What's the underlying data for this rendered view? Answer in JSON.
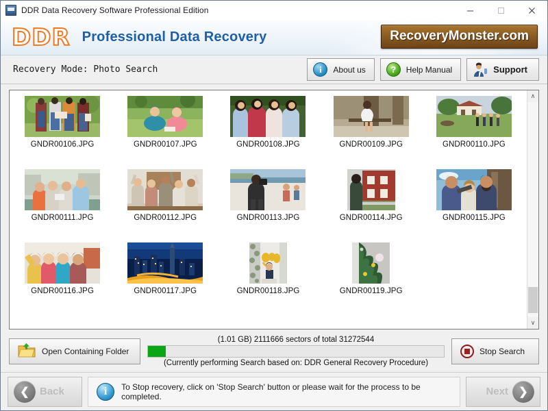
{
  "window": {
    "title": "DDR Data Recovery Software Professional Edition",
    "app_icon": "app-icon",
    "minimize": "—",
    "maximize": "□",
    "close": "✕"
  },
  "brand": {
    "logo_letters": [
      "D",
      "D",
      "R"
    ],
    "title": "Professional Data Recovery",
    "site_badge": "RecoveryMonster.com"
  },
  "modebar": {
    "mode_text": "Recovery Mode: Photo Search",
    "buttons": [
      {
        "label": "About us",
        "icon": "info-icon",
        "glyph": "i"
      },
      {
        "label": "Help Manual",
        "icon": "question-icon",
        "glyph": "?"
      },
      {
        "label": "Support",
        "icon": "support-person-icon",
        "glyph": ""
      }
    ]
  },
  "filelist": {
    "files": [
      {
        "name": "GNDR00106.JPG",
        "thumb": "people-park-green"
      },
      {
        "name": "GNDR00107.JPG",
        "thumb": "kids-grass-green"
      },
      {
        "name": "GNDR00108.JPG",
        "thumb": "friends-hug-green"
      },
      {
        "name": "GNDR00109.JPG",
        "thumb": "girl-swing-tree"
      },
      {
        "name": "GNDR00110.JPG",
        "thumb": "house-field-group"
      },
      {
        "name": "GNDR00111.JPG",
        "thumb": "friends-city-river"
      },
      {
        "name": "GNDR00112.JPG",
        "thumb": "team-cheering-office"
      },
      {
        "name": "GNDR00113.JPG",
        "thumb": "photographer-beach"
      },
      {
        "name": "GNDR00114.JPG",
        "thumb": "red-brick-house"
      },
      {
        "name": "GNDR00115.JPG",
        "thumb": "three-friends-sunny"
      },
      {
        "name": "GNDR00116.JPG",
        "thumb": "four-women-selfie"
      },
      {
        "name": "GNDR00117.JPG",
        "thumb": "dubai-night-skyline"
      },
      {
        "name": "GNDR00118.JPG",
        "thumb": "yay-balloons-child"
      },
      {
        "name": "GNDR00119.JPG",
        "thumb": "christmas-tree"
      }
    ],
    "scrollbar": {
      "up_arrow": "∧",
      "down_arrow": "∨"
    }
  },
  "actions": {
    "open_folder_label": "Open Containing Folder",
    "stop_search_label": "Stop Search",
    "progress_caption": "(1.01 GB) 2111666  sectors  of  total 31272544",
    "progress_note": "(Currently performing Search based on:  DDR General Recovery Procedure)",
    "progress_percent": 6,
    "progress_color": "#0aa614"
  },
  "footer": {
    "back_label": "Back",
    "next_label": "Next",
    "back_arrow": "❮",
    "next_arrow": "❯",
    "hint": "To Stop recovery, click on 'Stop Search' button or please wait for the process to be completed."
  }
}
